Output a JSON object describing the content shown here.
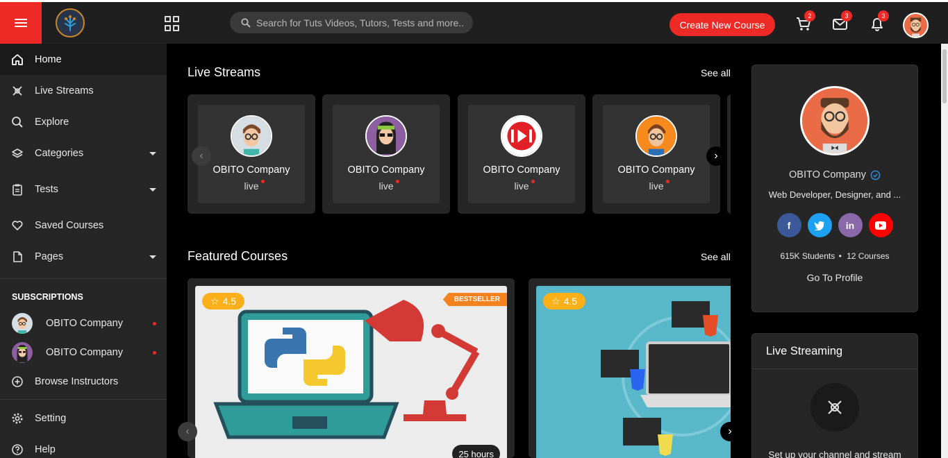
{
  "header": {
    "search_placeholder": "Search for Tuts Videos, Tutors, Tests and more..",
    "create_button": "Create New Course",
    "cart_badge": "2",
    "mail_badge": "3",
    "notif_badge": "3"
  },
  "sidebar": {
    "items": [
      {
        "label": "Home"
      },
      {
        "label": "Live Streams"
      },
      {
        "label": "Explore"
      },
      {
        "label": "Categories"
      },
      {
        "label": "Tests"
      },
      {
        "label": "Saved Courses"
      },
      {
        "label": "Pages"
      }
    ],
    "subscriptions_title": "SUBSCRIPTIONS",
    "subscriptions": [
      {
        "name": "OBITO Company"
      },
      {
        "name": "OBITO Company"
      }
    ],
    "browse_instructors": "Browse Instructors",
    "setting": "Setting",
    "help": "Help"
  },
  "live_streams": {
    "title": "Live Streams",
    "see_all": "See all",
    "cards": [
      {
        "name": "OBITO Company",
        "status": "live"
      },
      {
        "name": "OBITO Company",
        "status": "live"
      },
      {
        "name": "OBITO Company",
        "status": "live"
      },
      {
        "name": "OBITO Company",
        "status": "live"
      }
    ]
  },
  "featured": {
    "title": "Featured Courses",
    "see_all": "See all",
    "courses": [
      {
        "rating": "4.5",
        "badge": "BESTSELLER",
        "duration": "25 hours"
      },
      {
        "rating": "4.5"
      }
    ]
  },
  "profile": {
    "name": "OBITO Company",
    "role": "Web Developer, Designer, and ...",
    "students": "615K Students",
    "sep": "•",
    "courses": "12 Courses",
    "goto": "Go To Profile",
    "socials": {
      "facebook": "f",
      "linkedin": "in"
    }
  },
  "live_streaming_card": {
    "title": "Live Streaming",
    "text": "Set up your channel and stream"
  },
  "colors": {
    "accent": "#ed2a26",
    "facebook": "#3b5998",
    "twitter": "#1da1f2",
    "linkedin": "#8b68a9",
    "youtube": "#ff0000",
    "rating": "#fbb019"
  }
}
